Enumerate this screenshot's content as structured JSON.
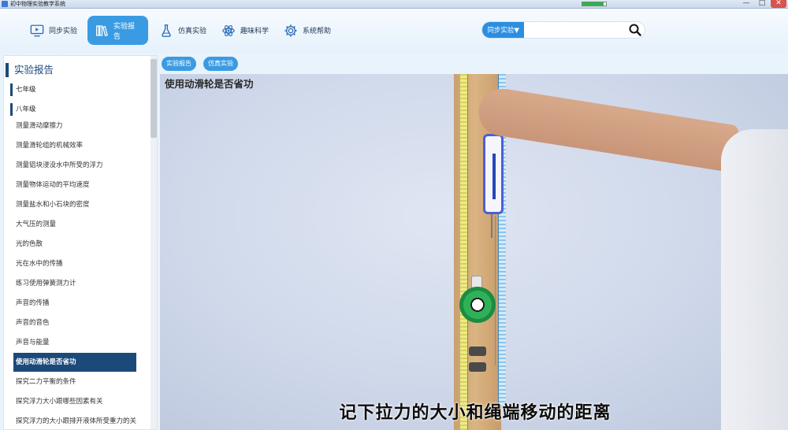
{
  "window": {
    "title": "初中物理实验教学系统",
    "controls": {
      "minimize": "—",
      "maximize": "□",
      "close": "✕"
    },
    "progress_fraction": 0.9
  },
  "nav": {
    "items": [
      {
        "label": "同步实验",
        "icon": "monitor-play-icon"
      },
      {
        "label": "实验报告",
        "icon": "books-icon",
        "active": true
      },
      {
        "label": "仿真实验",
        "icon": "flask-icon"
      },
      {
        "label": "趣味科学",
        "icon": "atom-icon"
      },
      {
        "label": "系统帮助",
        "icon": "gear-icon"
      }
    ]
  },
  "search": {
    "category": "同步实验▼",
    "value": "",
    "placeholder": ""
  },
  "sidebar": {
    "title": "实验报告",
    "grades": [
      "七年级",
      "八年级"
    ],
    "items": [
      "测量滑动摩擦力",
      "测量滑轮组的机械效率",
      "测量铝块浸没水中所受的浮力",
      "测量物体运动的平均速度",
      "测量盐水和小石块的密度",
      "大气压的测量",
      "光的色散",
      "光在水中的传播",
      "练习使用弹簧测力计",
      "声音的传播",
      "声音的音色",
      "声音与能量",
      "使用动滑轮是否省功",
      "探究二力平衡的条件",
      "探究浮力大小跟哪些因素有关",
      "探究浮力的大小跟排开液体所受重力的关"
    ],
    "active_index": 12
  },
  "tabs": [
    "实验报告",
    "仿真实验"
  ],
  "video": {
    "title": "使用动滑轮是否省功",
    "subtitle": "记下拉力的大小和绳端移动的距离"
  },
  "colors": {
    "accent": "#3a9be3",
    "sidebar_active": "#1b4a7a",
    "search_select": "#2c8ee0"
  }
}
